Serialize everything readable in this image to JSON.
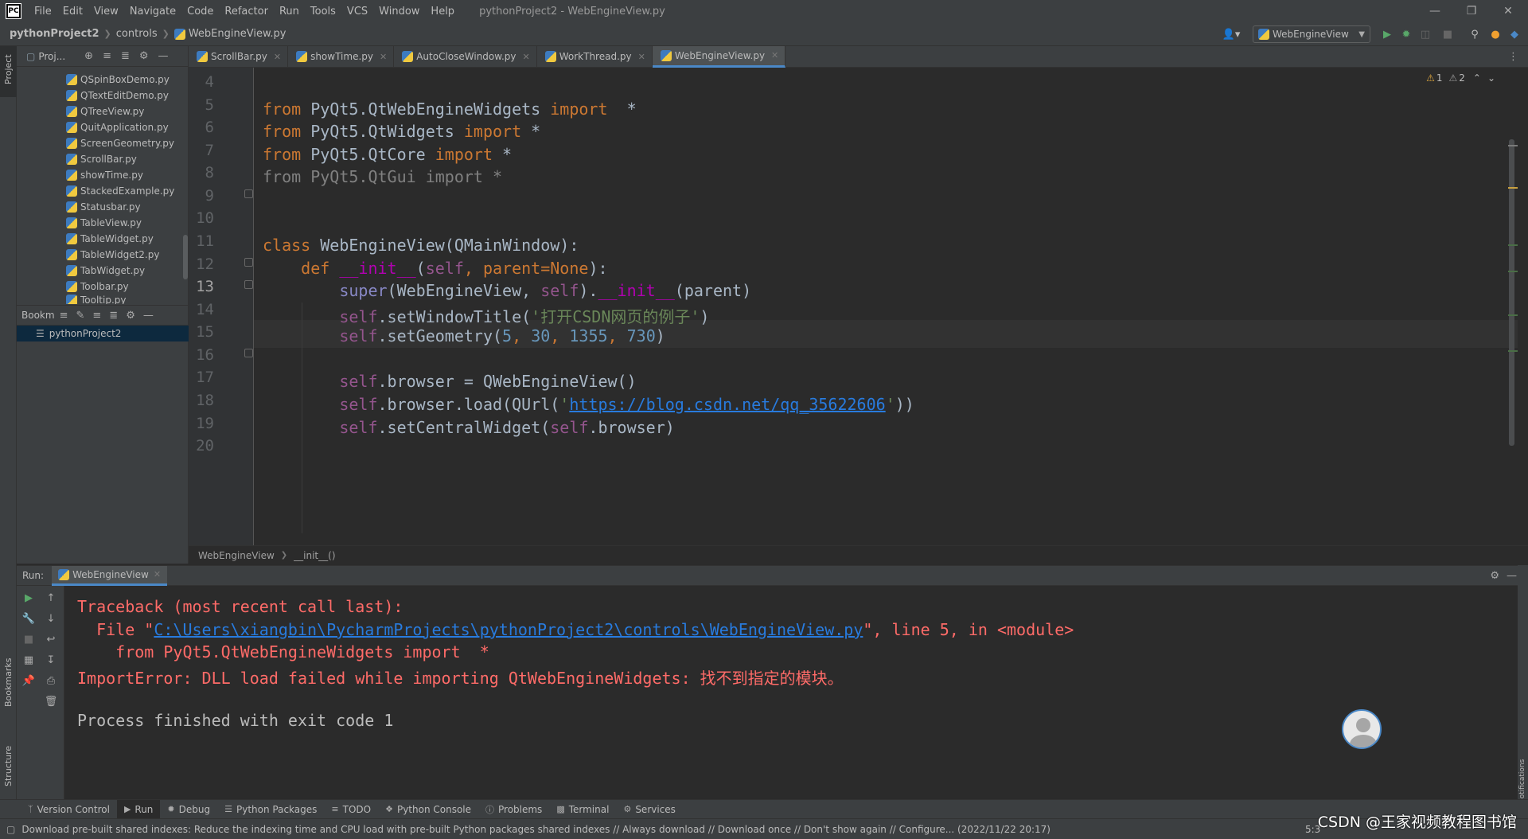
{
  "menubar": {
    "logo": "PC",
    "items": [
      "File",
      "Edit",
      "View",
      "Navigate",
      "Code",
      "Refactor",
      "Run",
      "Tools",
      "VCS",
      "Window",
      "Help"
    ],
    "title": "pythonProject2 - WebEngineView.py"
  },
  "navbar": {
    "project": "pythonProject2",
    "folder": "controls",
    "file": "WebEngineView.py",
    "run_config": "WebEngineView"
  },
  "left_stripe": {
    "project": "Project",
    "bookmarks": "Bookmarks",
    "structure": "Structure"
  },
  "project_panel": {
    "title": "Proj...",
    "files": [
      "QSpinBoxDemo.py",
      "QTextEditDemo.py",
      "QTreeView.py",
      "QuitApplication.py",
      "ScreenGeometry.py",
      "ScrollBar.py",
      "showTime.py",
      "StackedExample.py",
      "Statusbar.py",
      "TableView.py",
      "TableWidget.py",
      "TableWidget2.py",
      "TabWidget.py",
      "Toolbar.py",
      "Tooltip.py"
    ],
    "bookmarks_title": "Bookm",
    "bookmark_item": "pythonProject2"
  },
  "tabs": [
    {
      "label": "ScrollBar.py"
    },
    {
      "label": "showTime.py"
    },
    {
      "label": "AutoCloseWindow.py"
    },
    {
      "label": "WorkThread.py"
    },
    {
      "label": "WebEngineView.py"
    }
  ],
  "inspections": {
    "warnings": "1",
    "weak_warnings": "2"
  },
  "editor": {
    "lines": [
      "4",
      "5",
      "6",
      "7",
      "8",
      "9",
      "10",
      "11",
      "12",
      "13",
      "14",
      "15",
      "16",
      "17",
      "18",
      "19",
      "20"
    ],
    "current_line": "13",
    "code": {
      "l5_a": "from",
      "l5_b": " PyQt5.QtWebEngineWidgets ",
      "l5_c": "import",
      "l5_d": "  *",
      "l6_a": "from",
      "l6_b": " PyQt5.QtWidgets ",
      "l6_c": "import",
      "l6_d": " *",
      "l7_a": "from",
      "l7_b": " PyQt5.QtCore ",
      "l7_c": "import",
      "l7_d": " *",
      "l8": "from PyQt5.QtGui import *",
      "l11_a": "class",
      "l11_b": " WebEngineView(QMainWindow):",
      "l12_a": "def",
      "l12_b": " __init__",
      "l12_c": "(",
      "l12_d": "self",
      "l12_e": ", parent=",
      "l12_f": "None",
      "l12_g": "):",
      "l13_a": "super",
      "l13_b": "(WebEngineView, ",
      "l13_c": "self",
      "l13_d": ").",
      "l13_e": "__init__",
      "l13_f": "(parent)",
      "l14_a": "self",
      "l14_b": ".setWindowTitle(",
      "l14_c": "'打开CSDN网页的例子'",
      "l14_d": ")",
      "l15_a": "self",
      "l15_b": ".setGeometry(",
      "l15_c": "5",
      "l15_d": ", ",
      "l15_e": "30",
      "l15_f": ", ",
      "l15_g": "1355",
      "l15_h": ", ",
      "l15_i": "730",
      "l15_j": ")",
      "l17_a": "self",
      "l17_b": ".browser = QWebEngineView()",
      "l18_a": "self",
      "l18_b": ".browser.load(QUrl(",
      "l18_c": "'",
      "l18_d": "https://blog.csdn.net/qq_35622606",
      "l18_e": "'",
      "l18_f": "))",
      "l19_a": "self",
      "l19_b": ".setCentralWidget(",
      "l19_c": "self",
      "l19_d": ".browser)"
    }
  },
  "editor_breadcrumb": {
    "a": "WebEngineView",
    "b": "__init__()"
  },
  "run": {
    "label": "Run:",
    "tab": "WebEngineView",
    "console": {
      "c1": "Traceback (most recent call last):",
      "c2_a": "  File \"",
      "c2_b": "C:\\Users\\xiangbin\\PycharmProjects\\pythonProject2\\controls\\WebEngineView.py",
      "c2_c": "\", line 5, in <module>",
      "c3": "    from PyQt5.QtWebEngineWidgets import  *",
      "c4": "ImportError: DLL load failed while importing QtWebEngineWidgets: 找不到指定的模块。",
      "c5": "Process finished with exit code 1"
    }
  },
  "right_stripe": {
    "notifications": "Notifications"
  },
  "toolwindows": [
    "Version Control",
    "Run",
    "Debug",
    "Python Packages",
    "TODO",
    "Python Console",
    "Problems",
    "Terminal",
    "Services"
  ],
  "statusbar": {
    "message": "Download pre-built shared indexes: Reduce the indexing time and CPU load with pre-built Python packages shared indexes // Always download // Download once // Don't show again // Configure... (2022/11/22 20:17)",
    "position": "5:3"
  },
  "watermark": "CSDN @王家视频教程图书馆",
  "colors": {
    "keyword": "#cc7832",
    "self": "#94558d",
    "number": "#6897bb",
    "string": "#6a8759",
    "error": "#ff6b68",
    "accent": "#4a88c7"
  }
}
